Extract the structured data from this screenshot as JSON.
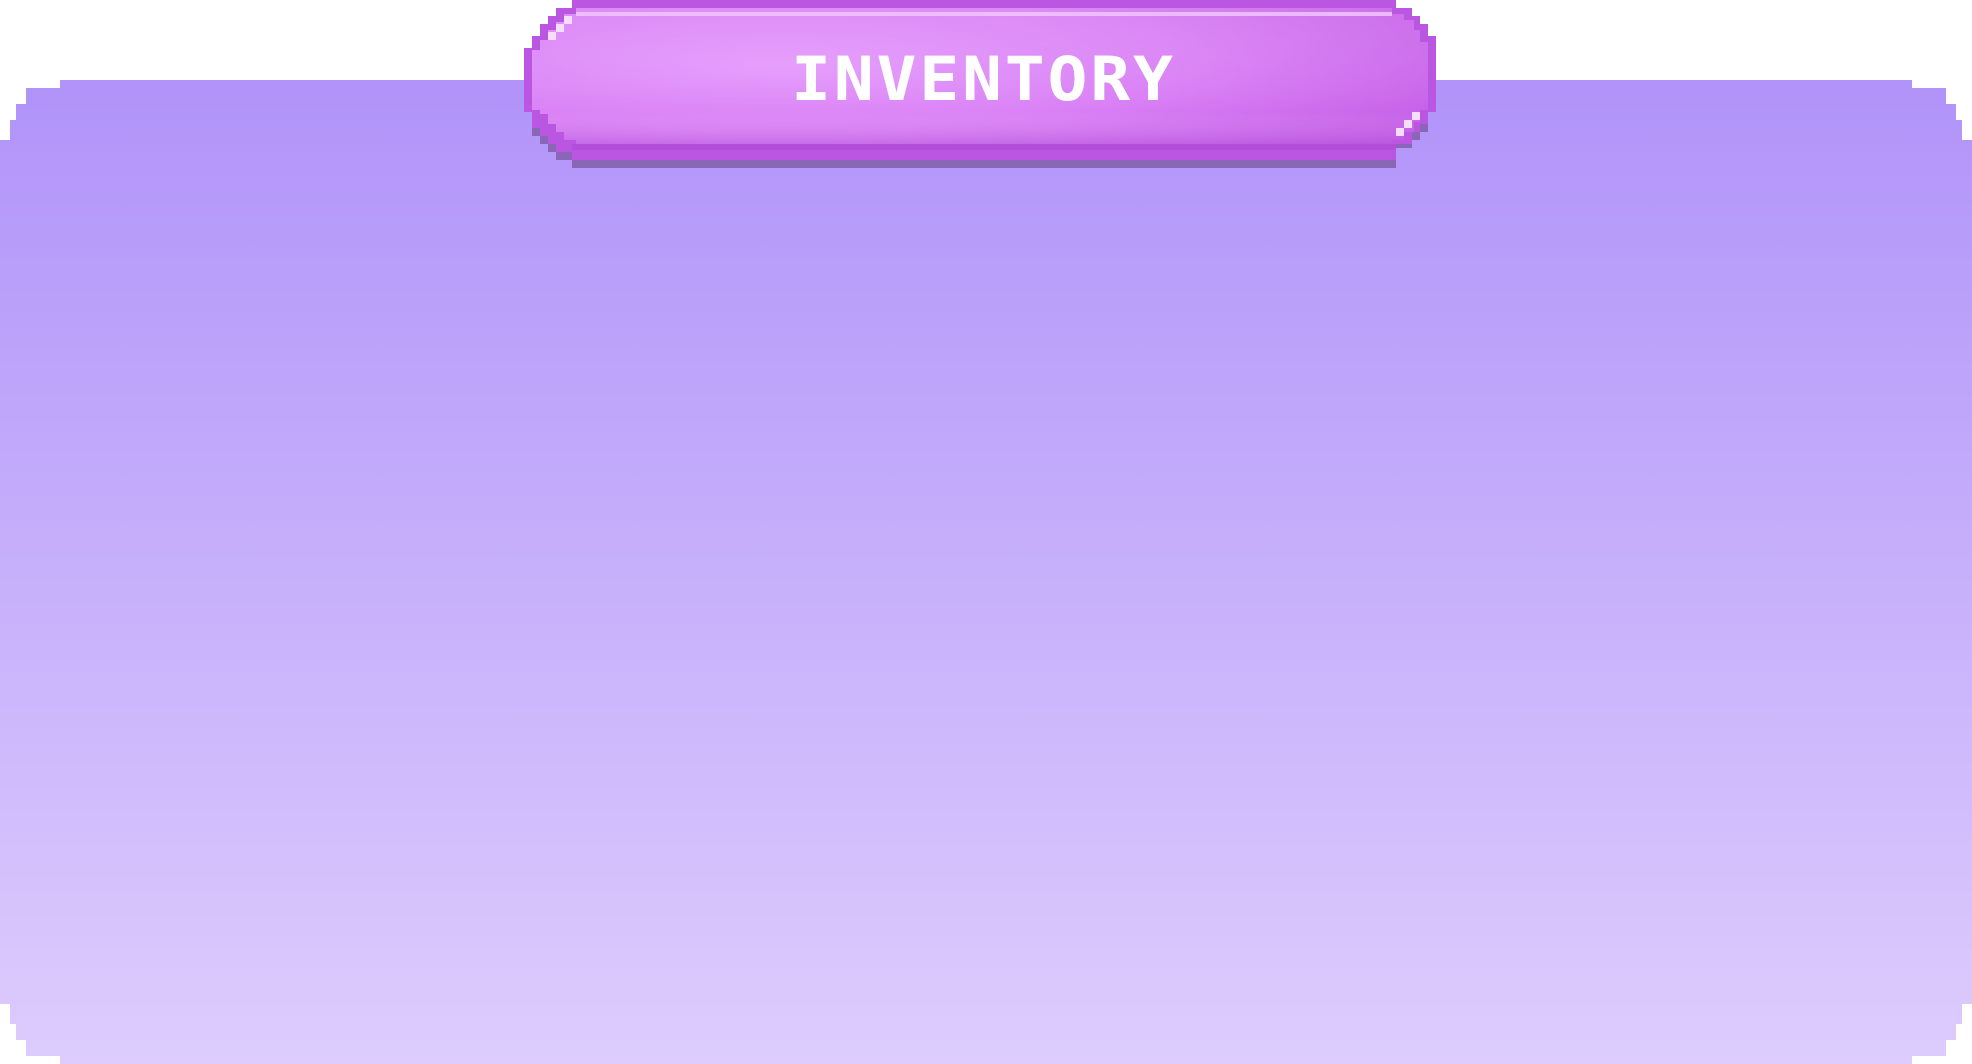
{
  "panel": {
    "title": "INVENTORY",
    "icon": "none"
  },
  "colors": {
    "panel_top": "#b193f9",
    "panel_bottom": "#ddccfd",
    "banner_light": "#e49bfc",
    "banner_mid": "#d576f1",
    "banner_dark": "#b24fd9",
    "banner_border": "#bb56e3",
    "banner_shadow": "#8966b6",
    "title_text": "#ffffff"
  }
}
